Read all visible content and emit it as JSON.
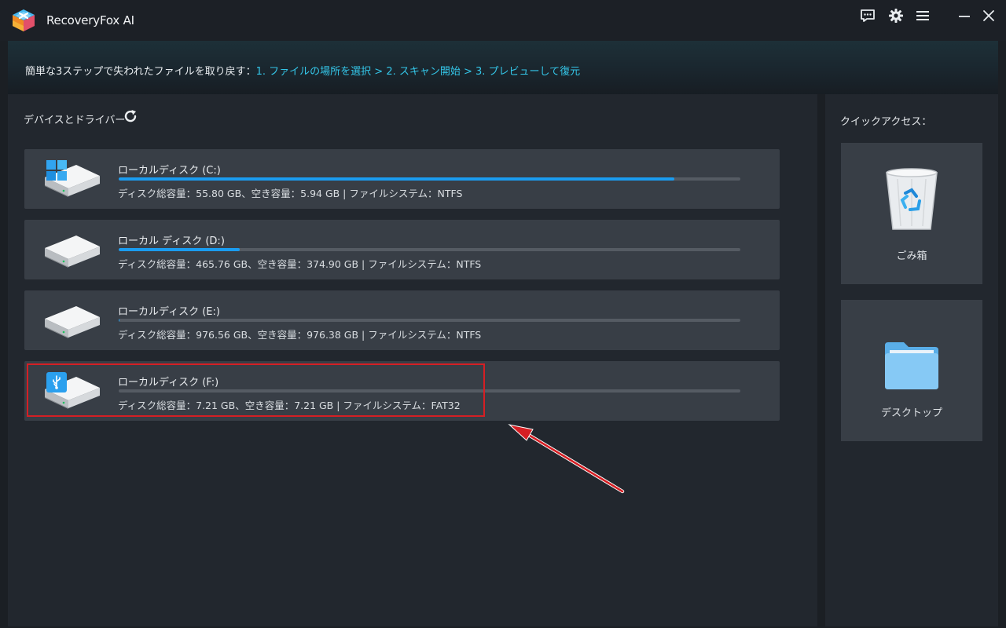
{
  "app": {
    "title": "RecoveryFox AI"
  },
  "banner": {
    "lead": "簡単な3ステップで失われたファイルを取り戻す：",
    "steps": "1. ファイルの場所を選択 > 2. スキャン開始 > 3. プレビューして復元"
  },
  "devices": {
    "title": "デバイスとドライバー",
    "drives": [
      {
        "name": "ローカルディスク (C:)",
        "info": "ディスク総容量：55.80 GB、空き容量：5.94 GB | ファイルシステム：NTFS",
        "used_fraction": 0.894,
        "icon": "windows-drive-icon"
      },
      {
        "name": "ローカル ディスク (D:)",
        "info": "ディスク総容量：465.76 GB、空き容量：374.90 GB | ファイルシステム：NTFS",
        "used_fraction": 0.195,
        "icon": "hard-drive-icon"
      },
      {
        "name": "ローカルディスク (E:)",
        "info": "ディスク総容量：976.56 GB、空き容量：976.38 GB | ファイルシステム：NTFS",
        "used_fraction": 0.0002,
        "icon": "hard-drive-icon"
      },
      {
        "name": "ローカルディスク (F:)",
        "info": "ディスク総容量：7.21 GB、空き容量：7.21 GB | ファイルシステム：FAT32",
        "used_fraction": 0.0,
        "icon": "usb-drive-icon"
      }
    ]
  },
  "quick_access": {
    "title": "クイックアクセス：",
    "items": [
      {
        "label": "ごみ箱",
        "icon": "recycle-bin-icon"
      },
      {
        "label": "デスクトップ",
        "icon": "folder-icon"
      }
    ]
  },
  "colors": {
    "accent": "#1a9cf0",
    "highlight": "#d51f24",
    "steps_text": "#34c6e8"
  }
}
